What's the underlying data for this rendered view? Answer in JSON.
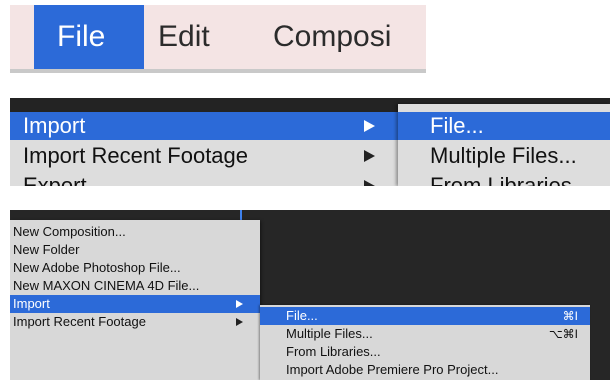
{
  "menubar": {
    "items": [
      "File",
      "Edit",
      "Composi"
    ],
    "active_index": 0
  },
  "zoom_menu": {
    "primary": [
      {
        "label": "Import",
        "has_submenu": true,
        "highlighted": true
      },
      {
        "label": "Import Recent Footage",
        "has_submenu": true,
        "highlighted": false
      },
      {
        "label": "Export",
        "has_submenu": true,
        "highlighted": false
      }
    ],
    "submenu": [
      {
        "label": "File...",
        "highlighted": true
      },
      {
        "label": "Multiple Files...",
        "highlighted": false
      },
      {
        "label": "From Libraries",
        "highlighted": false
      }
    ]
  },
  "full_menu": {
    "primary": [
      {
        "label": "New Composition...",
        "has_submenu": false
      },
      {
        "label": "New Folder",
        "has_submenu": false
      },
      {
        "label": "New Adobe Photoshop File...",
        "has_submenu": false
      },
      {
        "label": "New MAXON CINEMA 4D File...",
        "has_submenu": false
      },
      {
        "label": "Import",
        "has_submenu": true,
        "highlighted": true
      },
      {
        "label": "Import Recent Footage",
        "has_submenu": true
      }
    ],
    "submenu": [
      {
        "label": "File...",
        "shortcut": "⌘I",
        "highlighted": true
      },
      {
        "label": "Multiple Files...",
        "shortcut": "⌥⌘I"
      },
      {
        "label": "From Libraries...",
        "shortcut": ""
      },
      {
        "label": "Import Adobe Premiere Pro Project...",
        "shortcut": ""
      }
    ]
  },
  "colors": {
    "highlight": "#2c6ad8",
    "menu_bg": "#dddddd",
    "dark_bg": "#232323",
    "menubar_bg": "#f4e4e4"
  }
}
